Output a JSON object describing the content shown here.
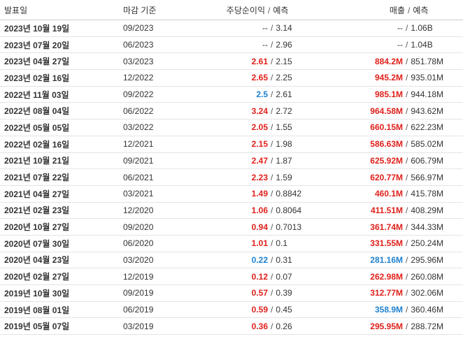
{
  "headers": {
    "date": "발표일",
    "period": "마감 기준",
    "eps": "주당순이익",
    "eps_est": "예측",
    "revenue": "매출",
    "revenue_est": "예측",
    "sep": "/"
  },
  "colors": {
    "beat": "#e0201b",
    "miss": "#1e81cf",
    "neutral": "#333333"
  },
  "rows": [
    {
      "date": "2023년 10월 19일",
      "period": "09/2023",
      "eps": "--",
      "eps_est": "3.14",
      "eps_c": "neu",
      "rev": "--",
      "rev_est": "1.06B",
      "rev_c": "neu"
    },
    {
      "date": "2023년 07월 20일",
      "period": "06/2023",
      "eps": "--",
      "eps_est": "2.96",
      "eps_c": "neu",
      "rev": "--",
      "rev_est": "1.04B",
      "rev_c": "neu"
    },
    {
      "date": "2023년 04월 27일",
      "period": "03/2023",
      "eps": "2.61",
      "eps_est": "2.15",
      "eps_c": "pos",
      "rev": "884.2M",
      "rev_est": "851.78M",
      "rev_c": "pos"
    },
    {
      "date": "2023년 02월 16일",
      "period": "12/2022",
      "eps": "2.65",
      "eps_est": "2.25",
      "eps_c": "pos",
      "rev": "945.2M",
      "rev_est": "935.01M",
      "rev_c": "pos"
    },
    {
      "date": "2022년 11월 03일",
      "period": "09/2022",
      "eps": "2.5",
      "eps_est": "2.61",
      "eps_c": "neg",
      "rev": "985.1M",
      "rev_est": "944.18M",
      "rev_c": "pos"
    },
    {
      "date": "2022년 08월 04일",
      "period": "06/2022",
      "eps": "3.24",
      "eps_est": "2.72",
      "eps_c": "pos",
      "rev": "964.58M",
      "rev_est": "943.62M",
      "rev_c": "pos"
    },
    {
      "date": "2022년 05월 05일",
      "period": "03/2022",
      "eps": "2.05",
      "eps_est": "1.55",
      "eps_c": "pos",
      "rev": "660.15M",
      "rev_est": "622.23M",
      "rev_c": "pos"
    },
    {
      "date": "2022년 02월 16일",
      "period": "12/2021",
      "eps": "2.15",
      "eps_est": "1.98",
      "eps_c": "pos",
      "rev": "586.63M",
      "rev_est": "585.02M",
      "rev_c": "pos"
    },
    {
      "date": "2021년 10월 21일",
      "period": "09/2021",
      "eps": "2.47",
      "eps_est": "1.87",
      "eps_c": "pos",
      "rev": "625.92M",
      "rev_est": "606.79M",
      "rev_c": "pos"
    },
    {
      "date": "2021년 07월 22일",
      "period": "06/2021",
      "eps": "2.23",
      "eps_est": "1.59",
      "eps_c": "pos",
      "rev": "620.77M",
      "rev_est": "566.97M",
      "rev_c": "pos"
    },
    {
      "date": "2021년 04월 27일",
      "period": "03/2021",
      "eps": "1.49",
      "eps_est": "0.8842",
      "eps_c": "pos",
      "rev": "460.1M",
      "rev_est": "415.78M",
      "rev_c": "pos"
    },
    {
      "date": "2021년 02월 23일",
      "period": "12/2020",
      "eps": "1.06",
      "eps_est": "0.8064",
      "eps_c": "pos",
      "rev": "411.51M",
      "rev_est": "408.29M",
      "rev_c": "pos"
    },
    {
      "date": "2020년 10월 27일",
      "period": "09/2020",
      "eps": "0.94",
      "eps_est": "0.7013",
      "eps_c": "pos",
      "rev": "361.74M",
      "rev_est": "344.33M",
      "rev_c": "pos"
    },
    {
      "date": "2020년 07월 30일",
      "period": "06/2020",
      "eps": "1.01",
      "eps_est": "0.1",
      "eps_c": "pos",
      "rev": "331.55M",
      "rev_est": "250.24M",
      "rev_c": "pos"
    },
    {
      "date": "2020년 04월 23일",
      "period": "03/2020",
      "eps": "0.22",
      "eps_est": "0.31",
      "eps_c": "neg",
      "rev": "281.16M",
      "rev_est": "295.96M",
      "rev_c": "neg"
    },
    {
      "date": "2020년 02월 27일",
      "period": "12/2019",
      "eps": "0.12",
      "eps_est": "0.07",
      "eps_c": "pos",
      "rev": "262.98M",
      "rev_est": "260.08M",
      "rev_c": "pos"
    },
    {
      "date": "2019년 10월 30일",
      "period": "09/2019",
      "eps": "0.57",
      "eps_est": "0.39",
      "eps_c": "pos",
      "rev": "312.77M",
      "rev_est": "302.06M",
      "rev_c": "pos"
    },
    {
      "date": "2019년 08월 01일",
      "period": "06/2019",
      "eps": "0.59",
      "eps_est": "0.45",
      "eps_c": "pos",
      "rev": "358.9M",
      "rev_est": "360.46M",
      "rev_c": "neg"
    },
    {
      "date": "2019년 05월 07일",
      "period": "03/2019",
      "eps": "0.36",
      "eps_est": "0.26",
      "eps_c": "pos",
      "rev": "295.95M",
      "rev_est": "288.72M",
      "rev_c": "pos"
    }
  ]
}
